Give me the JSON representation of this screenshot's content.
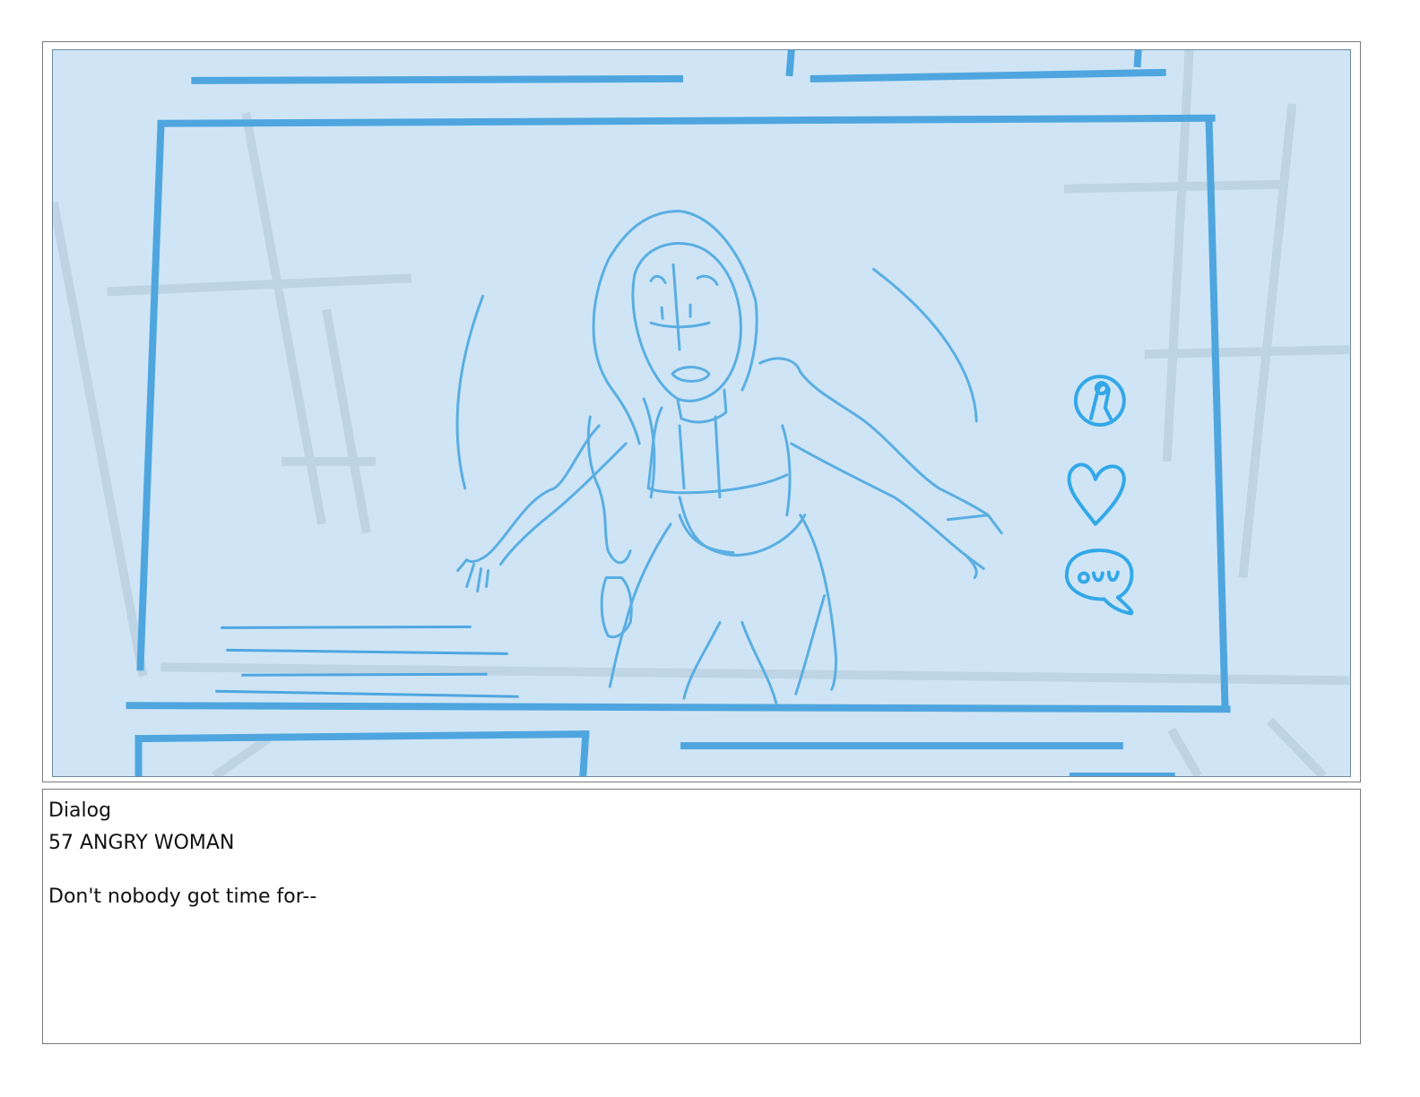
{
  "panel": {
    "background_color": "#cfe5f6",
    "stroke_color": "#4fa6df",
    "sketch_color": "#5aaee2",
    "icons": [
      "profile-icon",
      "heart-icon",
      "chat-bubble-icon"
    ]
  },
  "dialog": {
    "heading": "Dialog",
    "character": "57 ANGRY WOMAN",
    "line": "Don't nobody got time for--"
  }
}
